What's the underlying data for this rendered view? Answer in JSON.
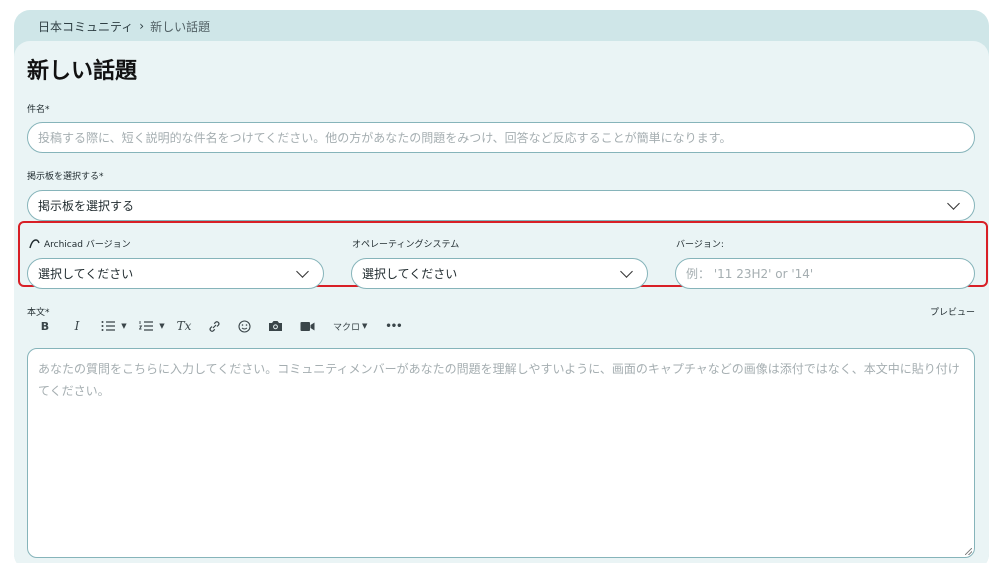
{
  "breadcrumb": {
    "parent": "日本コミュニティ",
    "separator": "›",
    "current": "新しい話題"
  },
  "page_title": "新しい話題",
  "subject": {
    "label": "件名*",
    "placeholder": "投稿する際に、短く説明的な件名をつけてください。他の方があなたの問題をみつけ、回答など反応することが簡単になります。"
  },
  "board": {
    "label": "掲示板を選択する*",
    "selected": "掲示板を選択する"
  },
  "archicad_version": {
    "label": "Archicad バージョン",
    "selected": "選択してください"
  },
  "os": {
    "label": "オペレーティングシステム",
    "selected": "選択してください"
  },
  "version": {
    "label": "バージョン:",
    "placeholder": "例： '11 23H2' or '14'"
  },
  "body": {
    "label": "本文*",
    "preview_label": "プレビュー",
    "placeholder": "あなたの質問をこちらに入力してください。コミュニティメンバーがあなたの問題を理解しやすいように、画面のキャプチャなどの画像は添付ではなく、本文中に貼り付けてください。"
  },
  "toolbar": {
    "bold": "B",
    "italic": "I",
    "clear_format": "Tx",
    "macro_label": "マクロ",
    "more": "•••"
  },
  "colors": {
    "outer_bg": "#cfe6e8",
    "card_bg": "#eaf4f5",
    "field_border": "#86b4ba",
    "highlight": "#d81f26",
    "placeholder": "#a5aeb1"
  }
}
